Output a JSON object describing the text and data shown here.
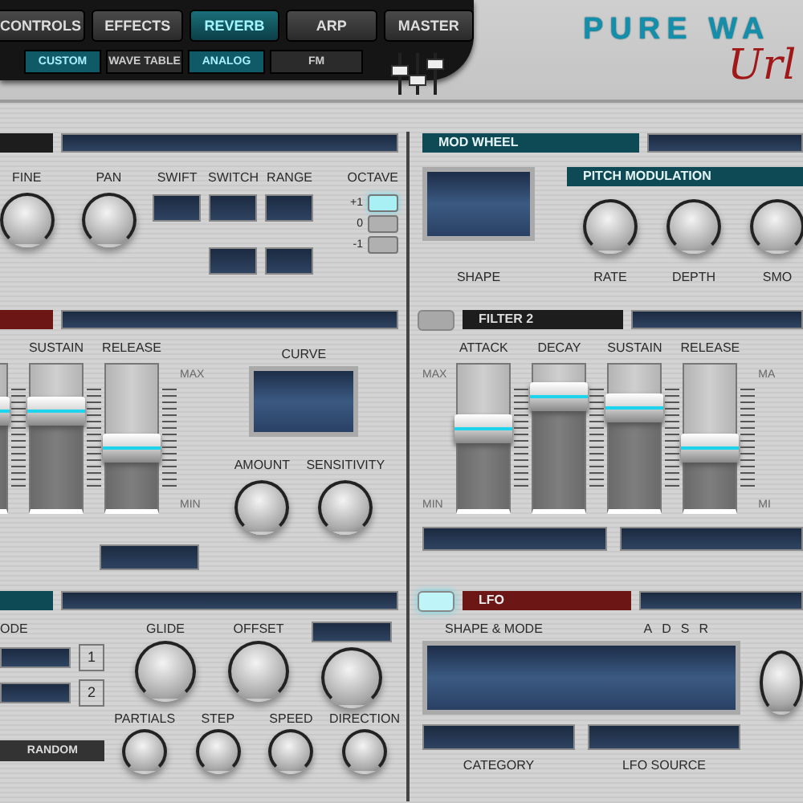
{
  "tabs": [
    {
      "label": "CONTROLS",
      "selected": false
    },
    {
      "label": "EFFECTS",
      "selected": false
    },
    {
      "label": "REVERB",
      "selected": true
    },
    {
      "label": "ARP",
      "selected": false
    },
    {
      "label": "MASTER",
      "selected": false
    }
  ],
  "subtabs": [
    {
      "label": "CUSTOM",
      "selected": true
    },
    {
      "label": "WAVE TABLE",
      "selected": false
    },
    {
      "label": "ANALOG",
      "selected": true
    },
    {
      "label": "FM",
      "selected": false
    }
  ],
  "logo": {
    "title": "PURE WA",
    "script": "Url"
  },
  "oscillator": {
    "knobs": [
      "FINE",
      "PAN"
    ],
    "switch_labels": [
      "SWIFT",
      "SWITCH",
      "RANGE"
    ],
    "octave_label": "OCTAVE",
    "octave": [
      {
        "label": "+1",
        "selected": true
      },
      {
        "label": "0",
        "selected": false
      },
      {
        "label": "-1",
        "selected": false
      }
    ]
  },
  "mod_wheel": {
    "header": "MOD WHEEL",
    "shape_label": "SHAPE",
    "pitch_header": "PITCH MODULATION",
    "knobs": [
      "RATE",
      "DEPTH",
      "SMO"
    ]
  },
  "envelope": {
    "max": "MAX",
    "min": "MIN",
    "curve_label": "CURVE",
    "knobs": [
      "AMOUNT",
      "SENSITIVITY"
    ],
    "sliders": [
      {
        "level": 0.78
      },
      {
        "label": "SUSTAIN",
        "level": 0.78
      },
      {
        "label": "RELEASE",
        "level": 0.52
      }
    ]
  },
  "filter2": {
    "enabled": false,
    "header": "FILTER 2",
    "max": "MAX",
    "min": "MIN",
    "edge_max": "MA",
    "edge_min": "MI",
    "sliders": [
      {
        "label": "ATTACK",
        "level": 0.66
      },
      {
        "label": "DECAY",
        "level": 0.88
      },
      {
        "label": "SUSTAIN",
        "level": 0.8
      },
      {
        "label": "RELEASE",
        "level": 0.52
      }
    ]
  },
  "mode": {
    "label": "ODE",
    "slots": [
      "1",
      "2"
    ],
    "knobs": [
      "GLIDE",
      "OFFSET"
    ],
    "random": "RANDOM",
    "small_knobs": [
      "PARTIALS",
      "STEP",
      "SPEED",
      "DIRECTION"
    ]
  },
  "lfo": {
    "enabled": true,
    "header": "LFO",
    "shape_label": "SHAPE & MODE",
    "adsr": [
      "A",
      "D",
      "S",
      "R"
    ],
    "fields": [
      "CATEGORY",
      "LFO SOURCE"
    ]
  }
}
